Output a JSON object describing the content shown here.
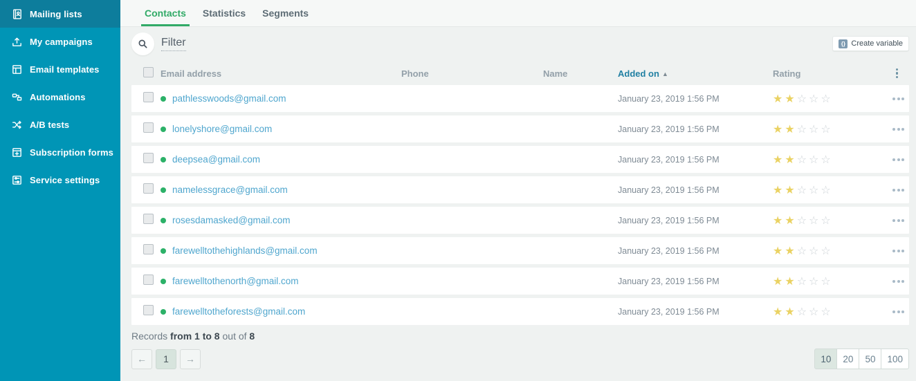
{
  "sidebar": {
    "items": [
      {
        "label": "Mailing lists",
        "icon": "address-book",
        "active": true
      },
      {
        "label": "My campaigns",
        "icon": "campaign-upload",
        "active": false
      },
      {
        "label": "Email templates",
        "icon": "email-templates",
        "active": false
      },
      {
        "label": "Automations",
        "icon": "automation",
        "active": false
      },
      {
        "label": "A/B tests",
        "icon": "ab-test",
        "active": false
      },
      {
        "label": "Subscription forms",
        "icon": "subscription-form",
        "active": false
      },
      {
        "label": "Service settings",
        "icon": "service-settings",
        "active": false
      }
    ]
  },
  "tabs": [
    {
      "label": "Contacts",
      "active": true
    },
    {
      "label": "Statistics",
      "active": false
    },
    {
      "label": "Segments",
      "active": false
    }
  ],
  "filter": {
    "label": "Filter"
  },
  "create_variable": {
    "label": "Create variable"
  },
  "table": {
    "header": {
      "email": "Email address",
      "phone": "Phone",
      "name": "Name",
      "added_on": "Added on",
      "rating": "Rating",
      "sort_column": "Added on",
      "sort_direction": "asc"
    },
    "rating_max": 5,
    "rows": [
      {
        "email": "pathlesswoods@gmail.com",
        "phone": "",
        "name": "",
        "added_on": "January 23, 2019 1:56 PM",
        "rating": 2
      },
      {
        "email": "lonelyshore@gmail.com",
        "phone": "",
        "name": "",
        "added_on": "January 23, 2019 1:56 PM",
        "rating": 2
      },
      {
        "email": "deepsea@gmail.com",
        "phone": "",
        "name": "",
        "added_on": "January 23, 2019 1:56 PM",
        "rating": 2
      },
      {
        "email": "namelessgrace@gmail.com",
        "phone": "",
        "name": "",
        "added_on": "January 23, 2019 1:56 PM",
        "rating": 2
      },
      {
        "email": "rosesdamasked@gmail.com",
        "phone": "",
        "name": "",
        "added_on": "January 23, 2019 1:56 PM",
        "rating": 2
      },
      {
        "email": "farewelltothehighlands@gmail.com",
        "phone": "",
        "name": "",
        "added_on": "January 23, 2019 1:56 PM",
        "rating": 2
      },
      {
        "email": "farewelltothenorth@gmail.com",
        "phone": "",
        "name": "",
        "added_on": "January 23, 2019 1:56 PM",
        "rating": 2
      },
      {
        "email": "farewelltotheforests@gmail.com",
        "phone": "",
        "name": "",
        "added_on": "January 23, 2019 1:56 PM",
        "rating": 2
      }
    ]
  },
  "footer": {
    "records_label": "Records",
    "records_range": "from 1 to 8",
    "records_out_of": "out of",
    "records_total": "8",
    "pagination": {
      "prev": "←",
      "current_page": "1",
      "next": "→"
    },
    "page_sizes": [
      "10",
      "20",
      "50",
      "100"
    ],
    "active_page_size": "10"
  },
  "icons": {
    "sort_asc": "▲",
    "variable": "{}",
    "star_filled": "★",
    "star_empty": "☆"
  },
  "colors": {
    "sidebar_bg": "#0095b6",
    "sidebar_active_bg": "#0d7d9c",
    "accent_green": "#31aa67",
    "link_blue": "#4fa6ce",
    "star_yellow": "#ead263",
    "star_empty": "#ccd2d6",
    "sorted_header": "#2180a3",
    "content_bg": "#eff2f1",
    "tabbar_bg": "#f6f8f7",
    "row_bg": "#ffffff",
    "dot_green": "#2cb168",
    "text_muted": "#93a0a9",
    "text_date": "#7f8b95",
    "pager_active_bg": "#d7e4dd"
  }
}
